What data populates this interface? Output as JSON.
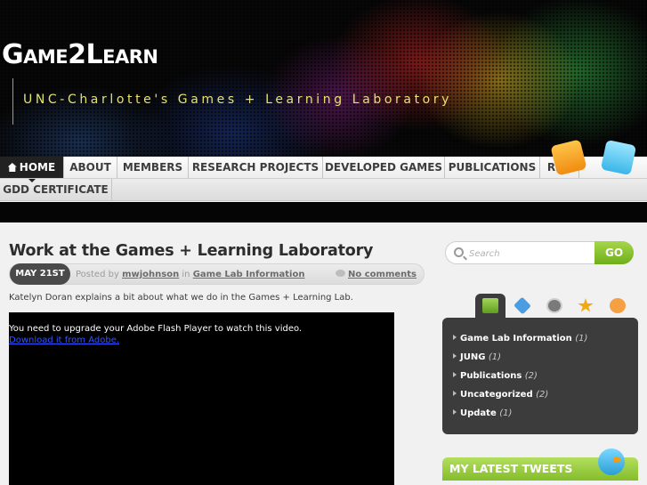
{
  "site": {
    "logo": "Game2Learn",
    "tagline": "UNC-Charlotte's Games + Learning Laboratory"
  },
  "nav": {
    "items": [
      {
        "label": "HOME",
        "active": true
      },
      {
        "label": "ABOUT"
      },
      {
        "label": "MEMBERS"
      },
      {
        "label": "RESEARCH PROJECTS"
      },
      {
        "label": "DEVELOPED GAMES"
      },
      {
        "label": "PUBLICATIONS"
      },
      {
        "label": "REU"
      },
      {
        "label": "GDD CERTIFICATE"
      }
    ]
  },
  "post": {
    "title": "Work at the Games + Learning Laboratory",
    "date": "MAY 21ST",
    "posted_by": "Posted by",
    "author": "mwjohnson",
    "in_word": "in",
    "category": "Game Lab Information",
    "comments": "No comments",
    "excerpt": "Katelyn Doran explains a bit about what we do in the Games + Learning Lab.",
    "flash_message": "You need to upgrade your Adobe Flash Player to watch this video.",
    "flash_link": "Download it from Adobe."
  },
  "sidebar": {
    "search_placeholder": "Search",
    "go_label": "GO",
    "categories": [
      {
        "name": "Game Lab Information",
        "count": "(1)"
      },
      {
        "name": "JUNG",
        "count": "(1)"
      },
      {
        "name": "Publications",
        "count": "(2)"
      },
      {
        "name": "Uncategorized",
        "count": "(2)"
      },
      {
        "name": "Update",
        "count": "(1)"
      }
    ],
    "tweets_title": "MY LATEST TWEETS"
  },
  "colors": {
    "accent_green": "#84bd2b",
    "tagline_yellow": "#e6e26a",
    "panel_dark": "#3c3c3c"
  }
}
